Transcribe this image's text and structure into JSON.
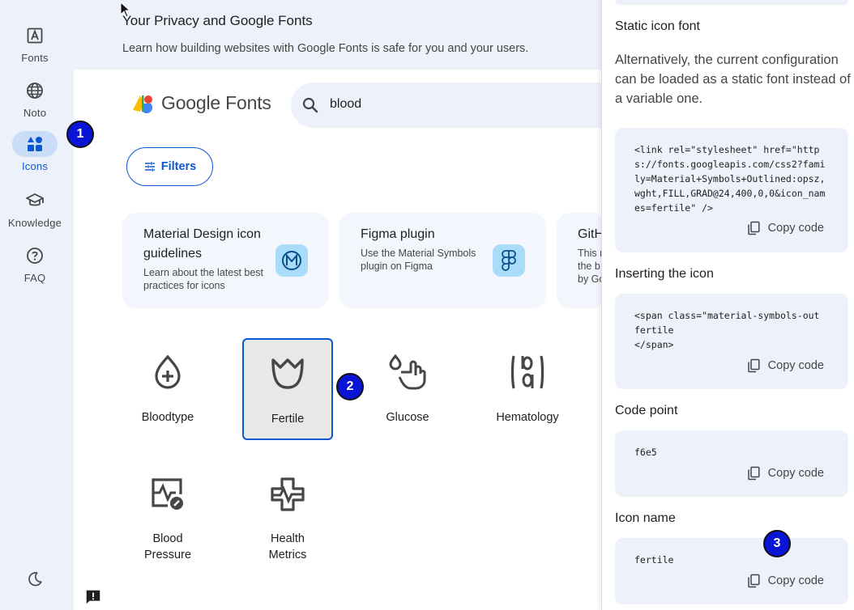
{
  "rail": {
    "items": [
      {
        "label": "Fonts",
        "icon": "fonts-icon"
      },
      {
        "label": "Noto",
        "icon": "globe-icon"
      },
      {
        "label": "Icons",
        "icon": "shapes-icon",
        "active": true
      },
      {
        "label": "Knowledge",
        "icon": "school-icon"
      },
      {
        "label": "FAQ",
        "icon": "help-icon"
      }
    ],
    "theme_icon": "dark-mode-icon"
  },
  "banner": {
    "title": "Your Privacy and Google Fonts",
    "subtitle": "Learn how building websites with Google Fonts is safe for you and your users."
  },
  "header": {
    "logo_text": "Google Fonts",
    "search_value": "blood"
  },
  "filters_label": "Filters",
  "cards": [
    {
      "title": "Material Design icon guidelines",
      "desc": "Learn about the latest best practices for icons"
    },
    {
      "title": "Figma plugin",
      "desc": "Use the Material Symbols plugin on Figma"
    },
    {
      "title": "GitH",
      "desc": "This r the b by Go"
    }
  ],
  "icons": [
    {
      "label": "Bloodtype"
    },
    {
      "label": "Fertile",
      "selected": true
    },
    {
      "label": "Glucose"
    },
    {
      "label": "Hematology"
    },
    {
      "label": "Blood Pressure"
    },
    {
      "label": "Health Metrics"
    }
  ],
  "panel": {
    "static_heading": "Static icon font",
    "static_para": "Alternatively, the current configuration can be loaded as a static font instead of a variable one.",
    "static_code": "<link rel=\"stylesheet\" href=\"https://fonts.googleapis.com/css2?family=Material+Symbols+Outlined:opsz,wght,FILL,GRAD@24,400,0,0&icon_names=fertile\" />",
    "insert_heading": "Inserting the icon",
    "insert_code": "<span class=\"material-symbols-out\nfertile\n</span>",
    "codepoint_heading": "Code point",
    "codepoint_value": "f6e5",
    "iconname_heading": "Icon name",
    "iconname_value": "fertile",
    "copy_label": "Copy code"
  },
  "markers": [
    "1",
    "2",
    "3"
  ],
  "colors": {
    "accent": "#0b57d0",
    "rail_bg": "#edf1f9",
    "marker": "#0a14d6"
  }
}
